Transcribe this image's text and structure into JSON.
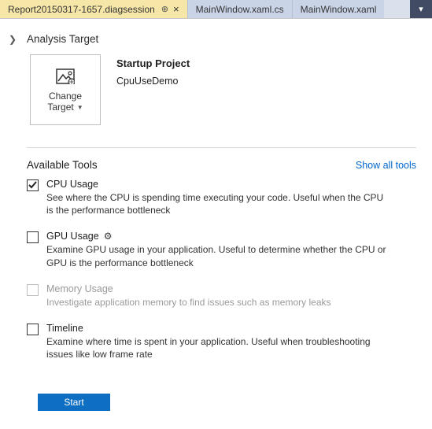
{
  "tabs": {
    "active": "Report20150317-1657.diagsession",
    "others": [
      "MainWindow.xaml.cs",
      "MainWindow.xaml"
    ]
  },
  "section": {
    "title": "Analysis Target"
  },
  "target_tile": {
    "line1": "Change",
    "line2": "Target"
  },
  "target": {
    "heading": "Startup Project",
    "project": "CpuUseDemo"
  },
  "tools_section": {
    "title": "Available Tools",
    "show_all": "Show all tools"
  },
  "tools": [
    {
      "id": "cpu-usage",
      "name": "CPU Usage",
      "desc": "See where the CPU is spending time executing your code. Useful when the CPU is the performance bottleneck",
      "checked": true,
      "enabled": true,
      "gear": false
    },
    {
      "id": "gpu-usage",
      "name": "GPU Usage",
      "desc": "Examine GPU usage in your application. Useful to determine whether the CPU or GPU is the performance bottleneck",
      "checked": false,
      "enabled": true,
      "gear": true
    },
    {
      "id": "memory-usage",
      "name": "Memory Usage",
      "desc": "Investigate application memory to find issues such as memory leaks",
      "checked": false,
      "enabled": false,
      "gear": false
    },
    {
      "id": "timeline",
      "name": "Timeline",
      "desc": "Examine where time is spent in your application. Useful when troubleshooting issues like low frame rate",
      "checked": false,
      "enabled": true,
      "gear": false
    }
  ],
  "buttons": {
    "start": "Start"
  }
}
